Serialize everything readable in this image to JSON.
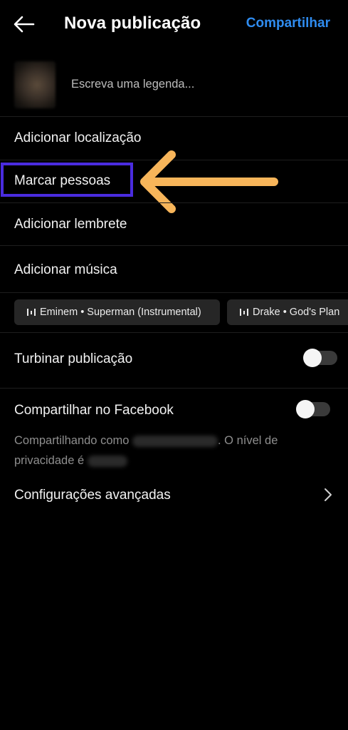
{
  "header": {
    "title": "Nova publicação",
    "share_label": "Compartilhar",
    "accent_color": "#2f8cf0"
  },
  "caption": {
    "placeholder": "Escreva uma legenda..."
  },
  "menu": {
    "add_location": "Adicionar localização",
    "tag_people": "Marcar pessoas",
    "add_reminder": "Adicionar lembrete",
    "add_music": "Adicionar música"
  },
  "music_suggestions": [
    {
      "label": "Eminem • Superman (Instrumental)"
    },
    {
      "label": "Drake • God's Plan"
    }
  ],
  "boost": {
    "label": "Turbinar publicação",
    "enabled": false
  },
  "facebook": {
    "label": "Compartilhar no Facebook",
    "enabled": false,
    "info_prefix": "Compartilhando como",
    "info_middle": ". O nível de privacidade é",
    "info_suffix": "."
  },
  "advanced": {
    "label": "Configurações avançadas"
  },
  "annotation": {
    "highlight_color": "#4a2ce0",
    "arrow_color": "#f7b55a"
  },
  "icons": [
    "back-arrow-icon",
    "music-bars-icon",
    "chevron-right-icon"
  ]
}
